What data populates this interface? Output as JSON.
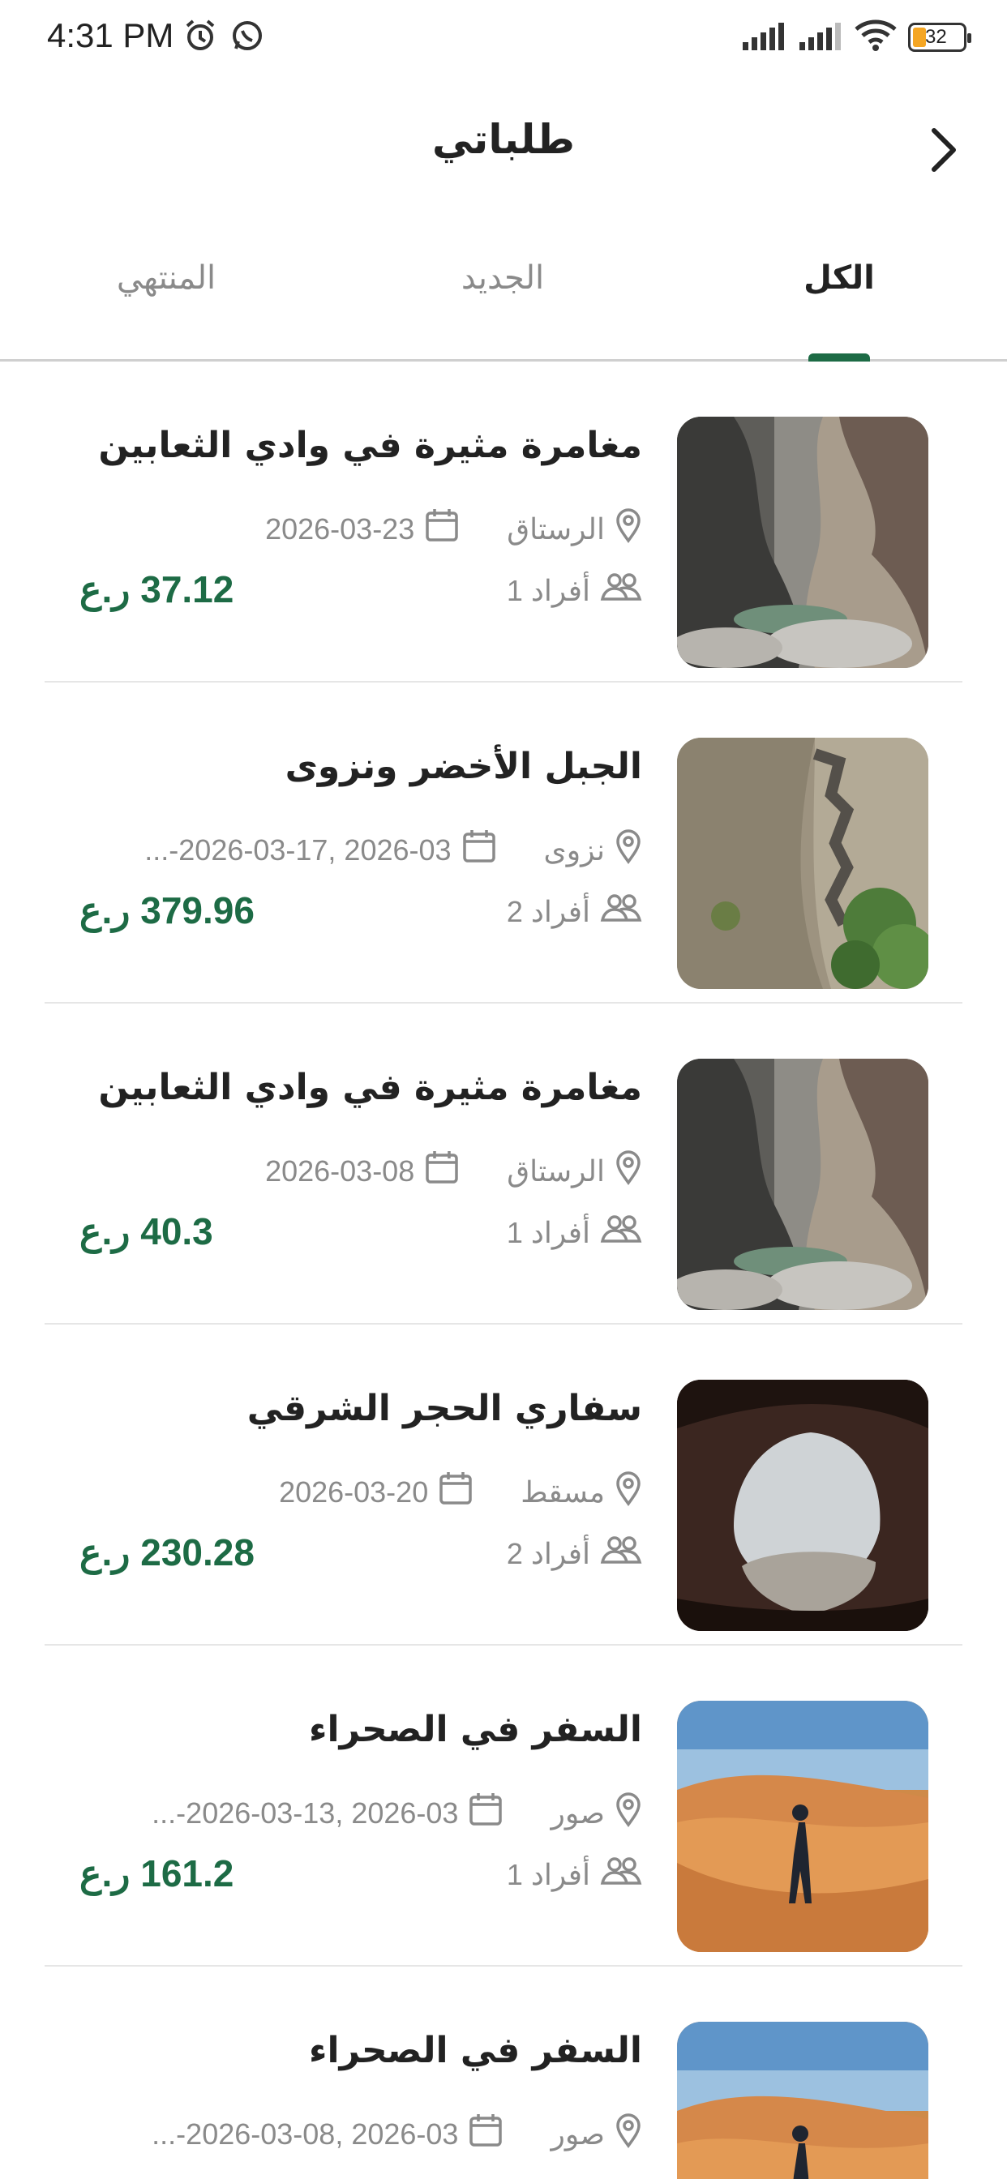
{
  "status_bar": {
    "time": "4:31 PM",
    "battery": "32",
    "icons": [
      "alarm-icon",
      "whatsapp-icon",
      "signal-icon",
      "signal-icon",
      "wifi-icon",
      "battery-icon"
    ]
  },
  "header": {
    "title": "طلباتي",
    "back_icon": "chevron-right-icon"
  },
  "tabs": [
    {
      "label": "الكل",
      "active": true
    },
    {
      "label": "الجديد",
      "active": false
    },
    {
      "label": "المنتهي",
      "active": false
    }
  ],
  "colors": {
    "accent": "#1d6b45",
    "muted": "#8a8a8a",
    "title": "#222222"
  },
  "bookings": [
    {
      "title": "مغامرة مثيرة في وادي الثعابين",
      "location": "الرستاق",
      "dates": "2026-03-23",
      "people": "1 أفراد",
      "price": "37.12 ر.ع",
      "image": "canyon"
    },
    {
      "title": "الجبل الأخضر ونزوى",
      "location": "نزوى",
      "dates": "...-2026-03-17, 2026-03",
      "people": "2 أفراد",
      "price": "379.96 ر.ع",
      "image": "cliff-stairs"
    },
    {
      "title": "مغامرة مثيرة في وادي الثعابين",
      "location": "الرستاق",
      "dates": "2026-03-08",
      "people": "1 أفراد",
      "price": "40.3 ر.ع",
      "image": "canyon"
    },
    {
      "title": "سفاري الحجر الشرقي",
      "location": "مسقط",
      "dates": "2026-03-20",
      "people": "2 أفراد",
      "price": "230.28 ر.ع",
      "image": "cave"
    },
    {
      "title": "السفر في الصحراء",
      "location": "صور",
      "dates": "...-2026-03-13, 2026-03",
      "people": "1 أفراد",
      "price": "161.2 ر.ع",
      "image": "desert"
    },
    {
      "title": "السفر في الصحراء",
      "location": "صور",
      "dates": "...-2026-03-08, 2026-03",
      "people": "",
      "price": "",
      "image": "desert"
    }
  ]
}
